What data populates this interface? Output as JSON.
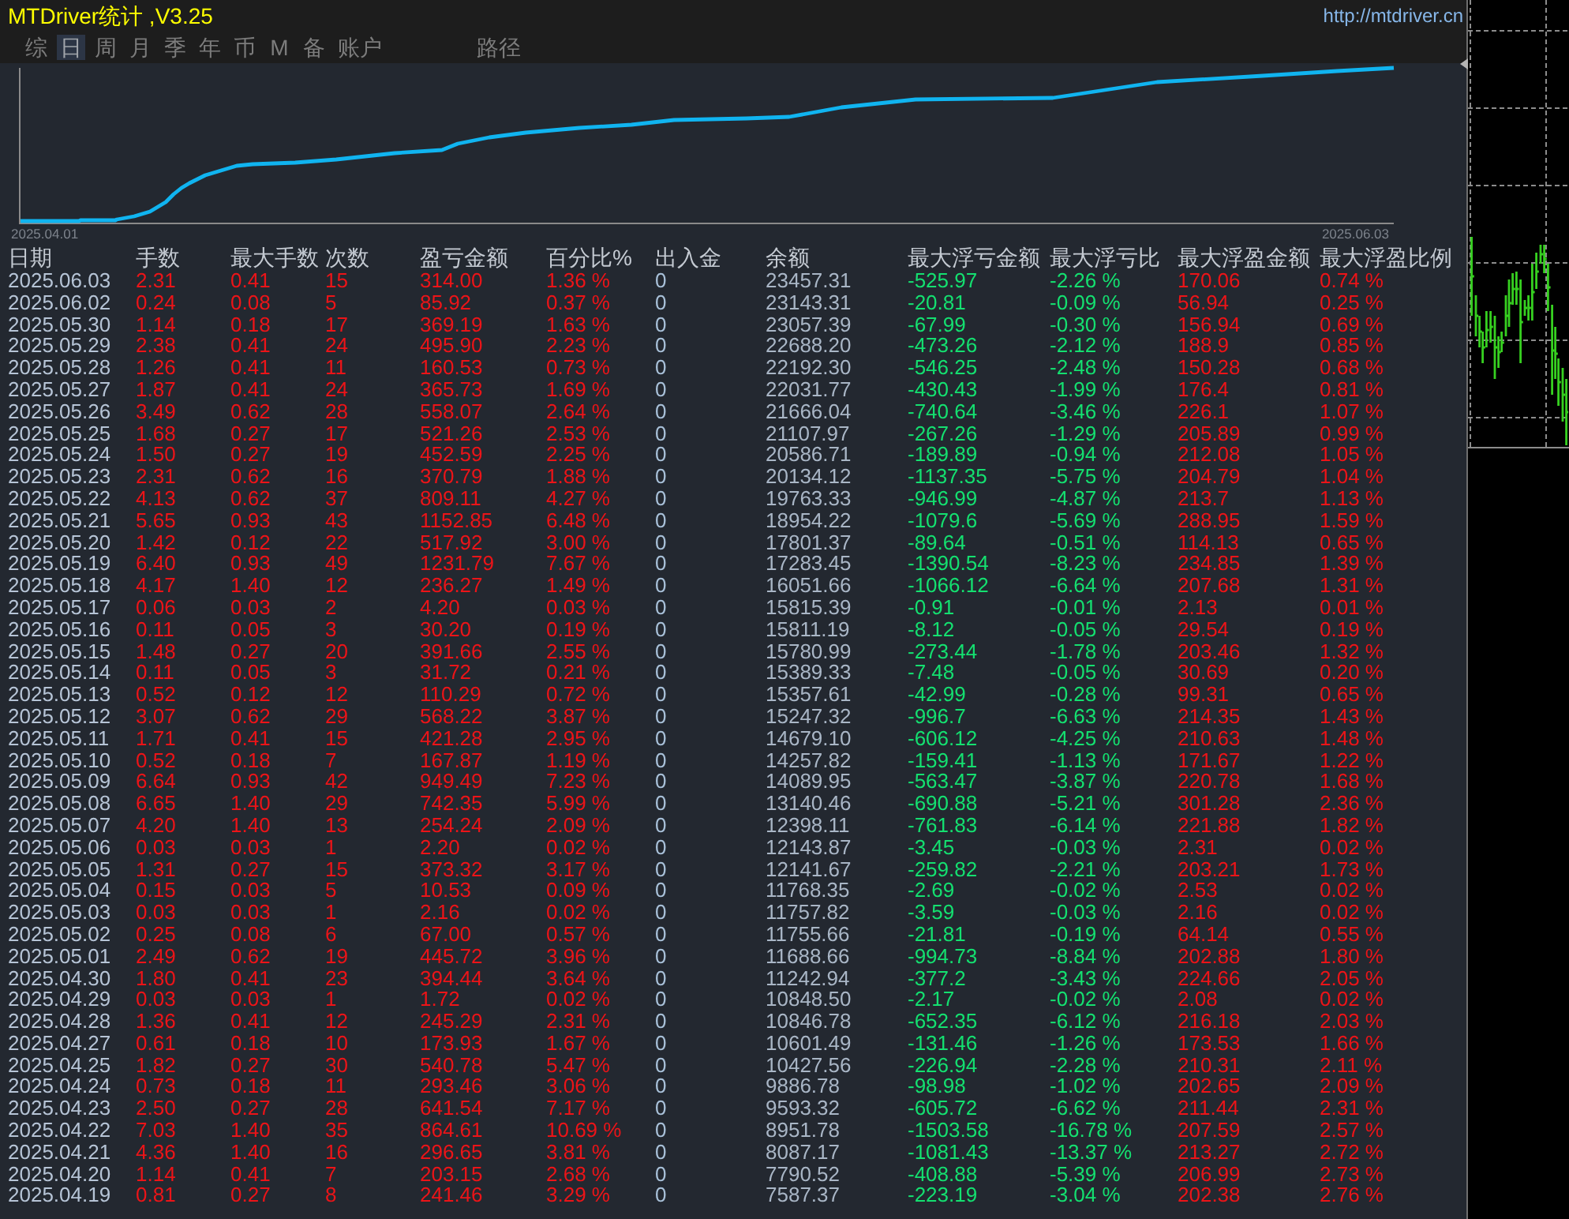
{
  "window": {
    "title": "MTDriver统计 ,V3.25",
    "link": "http://mtdriver.cn"
  },
  "tabs": [
    {
      "label": "综",
      "selected": false
    },
    {
      "label": "日",
      "selected": true
    },
    {
      "label": "周",
      "selected": false
    },
    {
      "label": "月",
      "selected": false
    },
    {
      "label": "季",
      "selected": false
    },
    {
      "label": "年",
      "selected": false
    },
    {
      "label": "币",
      "selected": false
    },
    {
      "label": "M",
      "selected": false
    },
    {
      "label": "备",
      "selected": false
    },
    {
      "label": "账户",
      "selected": false
    }
  ],
  "path_tab": {
    "label": "路径",
    "selected": false
  },
  "balance_chart": {
    "start_date": "2025.04.01",
    "end_date": "2025.06.03"
  },
  "table": {
    "columns": [
      "日期",
      "手数",
      "最大手数",
      "次数",
      "盈亏金额",
      "百分比%",
      "出入金",
      "余额",
      "最大浮亏金额",
      "最大浮亏比",
      "最大浮盈金额",
      "最大浮盈比例"
    ],
    "rows": [
      [
        "2025.06.03",
        "2.31",
        "0.41",
        "15",
        "314.00",
        "1.36 %",
        "0",
        "23457.31",
        "-525.97",
        "-2.26 %",
        "170.06",
        "0.74 %"
      ],
      [
        "2025.06.02",
        "0.24",
        "0.08",
        "5",
        "85.92",
        "0.37 %",
        "0",
        "23143.31",
        "-20.81",
        "-0.09 %",
        "56.94",
        "0.25 %"
      ],
      [
        "2025.05.30",
        "1.14",
        "0.18",
        "17",
        "369.19",
        "1.63 %",
        "0",
        "23057.39",
        "-67.99",
        "-0.30 %",
        "156.94",
        "0.69 %"
      ],
      [
        "2025.05.29",
        "2.38",
        "0.41",
        "24",
        "495.90",
        "2.23 %",
        "0",
        "22688.20",
        "-473.26",
        "-2.12 %",
        "188.9",
        "0.85 %"
      ],
      [
        "2025.05.28",
        "1.26",
        "0.41",
        "11",
        "160.53",
        "0.73 %",
        "0",
        "22192.30",
        "-546.25",
        "-2.48 %",
        "150.28",
        "0.68 %"
      ],
      [
        "2025.05.27",
        "1.87",
        "0.41",
        "24",
        "365.73",
        "1.69 %",
        "0",
        "22031.77",
        "-430.43",
        "-1.99 %",
        "176.4",
        "0.81 %"
      ],
      [
        "2025.05.26",
        "3.49",
        "0.62",
        "28",
        "558.07",
        "2.64 %",
        "0",
        "21666.04",
        "-740.64",
        "-3.46 %",
        "226.1",
        "1.07 %"
      ],
      [
        "2025.05.25",
        "1.68",
        "0.27",
        "17",
        "521.26",
        "2.53 %",
        "0",
        "21107.97",
        "-267.26",
        "-1.29 %",
        "205.89",
        "0.99 %"
      ],
      [
        "2025.05.24",
        "1.50",
        "0.27",
        "19",
        "452.59",
        "2.25 %",
        "0",
        "20586.71",
        "-189.89",
        "-0.94 %",
        "212.08",
        "1.05 %"
      ],
      [
        "2025.05.23",
        "2.31",
        "0.62",
        "16",
        "370.79",
        "1.88 %",
        "0",
        "20134.12",
        "-1137.35",
        "-5.75 %",
        "204.79",
        "1.04 %"
      ],
      [
        "2025.05.22",
        "4.13",
        "0.62",
        "37",
        "809.11",
        "4.27 %",
        "0",
        "19763.33",
        "-946.99",
        "-4.87 %",
        "213.7",
        "1.13 %"
      ],
      [
        "2025.05.21",
        "5.65",
        "0.93",
        "43",
        "1152.85",
        "6.48 %",
        "0",
        "18954.22",
        "-1079.6",
        "-5.69 %",
        "288.95",
        "1.59 %"
      ],
      [
        "2025.05.20",
        "1.42",
        "0.12",
        "22",
        "517.92",
        "3.00 %",
        "0",
        "17801.37",
        "-89.64",
        "-0.51 %",
        "114.13",
        "0.65 %"
      ],
      [
        "2025.05.19",
        "6.40",
        "0.93",
        "49",
        "1231.79",
        "7.67 %",
        "0",
        "17283.45",
        "-1390.54",
        "-8.23 %",
        "234.85",
        "1.39 %"
      ],
      [
        "2025.05.18",
        "4.17",
        "1.40",
        "12",
        "236.27",
        "1.49 %",
        "0",
        "16051.66",
        "-1066.12",
        "-6.64 %",
        "207.68",
        "1.31 %"
      ],
      [
        "2025.05.17",
        "0.06",
        "0.03",
        "2",
        "4.20",
        "0.03 %",
        "0",
        "15815.39",
        "-0.91",
        "-0.01 %",
        "2.13",
        "0.01 %"
      ],
      [
        "2025.05.16",
        "0.11",
        "0.05",
        "3",
        "30.20",
        "0.19 %",
        "0",
        "15811.19",
        "-8.12",
        "-0.05 %",
        "29.54",
        "0.19 %"
      ],
      [
        "2025.05.15",
        "1.48",
        "0.27",
        "20",
        "391.66",
        "2.55 %",
        "0",
        "15780.99",
        "-273.44",
        "-1.78 %",
        "203.46",
        "1.32 %"
      ],
      [
        "2025.05.14",
        "0.11",
        "0.05",
        "3",
        "31.72",
        "0.21 %",
        "0",
        "15389.33",
        "-7.48",
        "-0.05 %",
        "30.69",
        "0.20 %"
      ],
      [
        "2025.05.13",
        "0.52",
        "0.12",
        "12",
        "110.29",
        "0.72 %",
        "0",
        "15357.61",
        "-42.99",
        "-0.28 %",
        "99.31",
        "0.65 %"
      ],
      [
        "2025.05.12",
        "3.07",
        "0.62",
        "29",
        "568.22",
        "3.87 %",
        "0",
        "15247.32",
        "-996.7",
        "-6.63 %",
        "214.35",
        "1.43 %"
      ],
      [
        "2025.05.11",
        "1.71",
        "0.41",
        "15",
        "421.28",
        "2.95 %",
        "0",
        "14679.10",
        "-606.12",
        "-4.25 %",
        "210.63",
        "1.48 %"
      ],
      [
        "2025.05.10",
        "0.52",
        "0.18",
        "7",
        "167.87",
        "1.19 %",
        "0",
        "14257.82",
        "-159.41",
        "-1.13 %",
        "171.67",
        "1.22 %"
      ],
      [
        "2025.05.09",
        "6.64",
        "0.93",
        "42",
        "949.49",
        "7.23 %",
        "0",
        "14089.95",
        "-563.47",
        "-3.87 %",
        "220.78",
        "1.68 %"
      ],
      [
        "2025.05.08",
        "6.65",
        "1.40",
        "29",
        "742.35",
        "5.99 %",
        "0",
        "13140.46",
        "-690.88",
        "-5.21 %",
        "301.28",
        "2.36 %"
      ],
      [
        "2025.05.07",
        "4.20",
        "1.40",
        "13",
        "254.24",
        "2.09 %",
        "0",
        "12398.11",
        "-761.83",
        "-6.14 %",
        "221.88",
        "1.82 %"
      ],
      [
        "2025.05.06",
        "0.03",
        "0.03",
        "1",
        "2.20",
        "0.02 %",
        "0",
        "12143.87",
        "-3.45",
        "-0.03 %",
        "2.31",
        "0.02 %"
      ],
      [
        "2025.05.05",
        "1.31",
        "0.27",
        "15",
        "373.32",
        "3.17 %",
        "0",
        "12141.67",
        "-259.82",
        "-2.21 %",
        "203.21",
        "1.73 %"
      ],
      [
        "2025.05.04",
        "0.15",
        "0.03",
        "5",
        "10.53",
        "0.09 %",
        "0",
        "11768.35",
        "-2.69",
        "-0.02 %",
        "2.53",
        "0.02 %"
      ],
      [
        "2025.05.03",
        "0.03",
        "0.03",
        "1",
        "2.16",
        "0.02 %",
        "0",
        "11757.82",
        "-3.59",
        "-0.03 %",
        "2.16",
        "0.02 %"
      ],
      [
        "2025.05.02",
        "0.25",
        "0.08",
        "6",
        "67.00",
        "0.57 %",
        "0",
        "11755.66",
        "-21.81",
        "-0.19 %",
        "64.14",
        "0.55 %"
      ],
      [
        "2025.05.01",
        "2.49",
        "0.62",
        "19",
        "445.72",
        "3.96 %",
        "0",
        "11688.66",
        "-994.73",
        "-8.84 %",
        "202.88",
        "1.80 %"
      ],
      [
        "2025.04.30",
        "1.80",
        "0.41",
        "23",
        "394.44",
        "3.64 %",
        "0",
        "11242.94",
        "-377.2",
        "-3.43 %",
        "224.66",
        "2.05 %"
      ],
      [
        "2025.04.29",
        "0.03",
        "0.03",
        "1",
        "1.72",
        "0.02 %",
        "0",
        "10848.50",
        "-2.17",
        "-0.02 %",
        "2.08",
        "0.02 %"
      ],
      [
        "2025.04.28",
        "1.36",
        "0.41",
        "12",
        "245.29",
        "2.31 %",
        "0",
        "10846.78",
        "-652.35",
        "-6.12 %",
        "216.18",
        "2.03 %"
      ],
      [
        "2025.04.27",
        "0.61",
        "0.18",
        "10",
        "173.93",
        "1.67 %",
        "0",
        "10601.49",
        "-131.46",
        "-1.26 %",
        "173.53",
        "1.66 %"
      ],
      [
        "2025.04.25",
        "1.82",
        "0.27",
        "30",
        "540.78",
        "5.47 %",
        "0",
        "10427.56",
        "-226.94",
        "-2.28 %",
        "210.31",
        "2.11 %"
      ],
      [
        "2025.04.24",
        "0.73",
        "0.18",
        "11",
        "293.46",
        "3.06 %",
        "0",
        "9886.78",
        "-98.98",
        "-1.02 %",
        "202.65",
        "2.09 %"
      ],
      [
        "2025.04.23",
        "2.50",
        "0.27",
        "28",
        "641.54",
        "7.17 %",
        "0",
        "9593.32",
        "-605.72",
        "-6.62 %",
        "211.44",
        "2.31 %"
      ],
      [
        "2025.04.22",
        "7.03",
        "1.40",
        "35",
        "864.61",
        "10.69 %",
        "0",
        "8951.78",
        "-1503.58",
        "-16.78 %",
        "207.59",
        "2.57 %"
      ],
      [
        "2025.04.21",
        "4.36",
        "1.40",
        "16",
        "296.65",
        "3.81 %",
        "0",
        "8087.17",
        "-1081.43",
        "-13.37 %",
        "213.27",
        "2.72 %"
      ],
      [
        "2025.04.20",
        "1.14",
        "0.41",
        "7",
        "203.15",
        "2.68 %",
        "0",
        "7790.52",
        "-408.88",
        "-5.39 %",
        "206.99",
        "2.73 %"
      ],
      [
        "2025.04.19",
        "0.81",
        "0.27",
        "8",
        "241.46",
        "3.29 %",
        "0",
        "7587.37",
        "-223.19",
        "-3.04 %",
        "202.38",
        "2.76 %"
      ]
    ]
  }
}
